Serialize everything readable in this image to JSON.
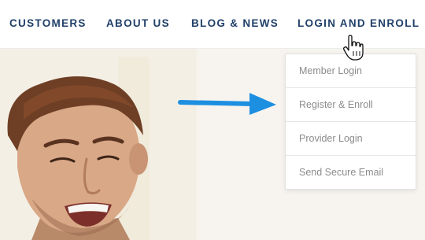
{
  "nav": {
    "customers": "CUSTOMERS",
    "about": "ABOUT US",
    "blog": "BLOG & NEWS",
    "login": "LOGIN AND ENROLL"
  },
  "dropdown": {
    "items": [
      {
        "label": "Member Login"
      },
      {
        "label": "Register & Enroll"
      },
      {
        "label": "Provider Login"
      },
      {
        "label": "Send Secure Email"
      }
    ]
  },
  "colors": {
    "nav_text": "#21406a",
    "dropdown_text": "#8c8c8c",
    "annotation_arrow": "#1d8fe1"
  },
  "icons": {
    "cursor": "hand-pointer-icon",
    "annotation": "arrow-right-icon"
  }
}
